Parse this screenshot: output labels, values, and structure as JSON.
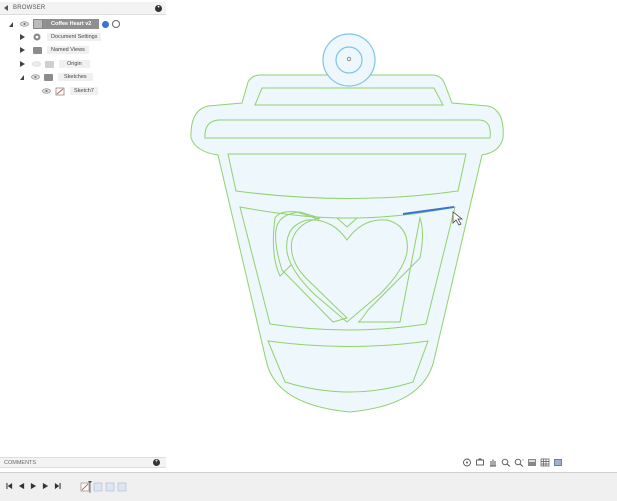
{
  "browser": {
    "title": "BROWSER",
    "root": "Coffee Heart v2",
    "items": [
      {
        "label": "Document Settings",
        "icon": "gear-icon"
      },
      {
        "label": "Named Views",
        "icon": "folder-icon"
      },
      {
        "label": "Origin",
        "icon": "folder-icon"
      },
      {
        "label": "Sketches",
        "icon": "folder-icon"
      },
      {
        "label": "Sketch7",
        "icon": "sketch-icon"
      }
    ]
  },
  "comments": {
    "title": "COMMENTS"
  },
  "colors": {
    "sketch_line": "#8fd26f",
    "fill": "#eef7fb",
    "selected_line": "#3a73d6",
    "circle": "#7fc3e8"
  }
}
